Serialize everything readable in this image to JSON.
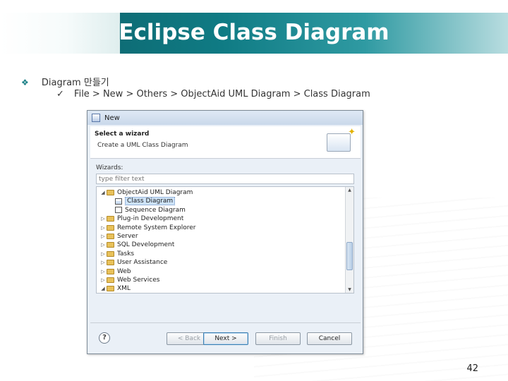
{
  "slide": {
    "title": "Eclipse Class Diagram",
    "bullet1": "Diagram 만들기",
    "bullet2": "File > New > Others > ObjectAid UML Diagram > Class Diagram",
    "page_number": "42",
    "bullet1_marker": "❖",
    "bullet2_marker": "✓"
  },
  "dialog": {
    "title": "New",
    "header_title": "Select a wizard",
    "header_subtitle": "Create a UML Class Diagram",
    "wizards_label": "Wizards:",
    "filter_placeholder": "type filter text",
    "tree": [
      {
        "label": "ObjectAid UML Diagram",
        "level": 0,
        "expanded": true,
        "icon": "folder-icon"
      },
      {
        "label": "Class Diagram",
        "level": 1,
        "selected": true,
        "icon": "class-diagram-icon"
      },
      {
        "label": "Sequence Diagram",
        "level": 1,
        "icon": "sequence-diagram-icon"
      },
      {
        "label": "Plug-in Development",
        "level": 0,
        "expanded": false,
        "icon": "folder-icon"
      },
      {
        "label": "Remote System Explorer",
        "level": 0,
        "expanded": false,
        "icon": "folder-icon"
      },
      {
        "label": "Server",
        "level": 0,
        "expanded": false,
        "icon": "folder-icon"
      },
      {
        "label": "SQL Development",
        "level": 0,
        "expanded": false,
        "icon": "folder-icon"
      },
      {
        "label": "Tasks",
        "level": 0,
        "expanded": false,
        "icon": "folder-icon"
      },
      {
        "label": "User Assistance",
        "level": 0,
        "expanded": false,
        "icon": "folder-icon"
      },
      {
        "label": "Web",
        "level": 0,
        "expanded": false,
        "icon": "folder-icon"
      },
      {
        "label": "Web Services",
        "level": 0,
        "expanded": false,
        "icon": "folder-icon"
      },
      {
        "label": "XML",
        "level": 0,
        "expanded": true,
        "icon": "folder-icon"
      }
    ],
    "buttons": {
      "back": "< Back",
      "next": "Next >",
      "finish": "Finish",
      "cancel": "Cancel",
      "help": "?"
    }
  },
  "colors": {
    "title_bar": "#0f7b84",
    "selection": "#cde3f8",
    "folder": "#e8c15a"
  }
}
